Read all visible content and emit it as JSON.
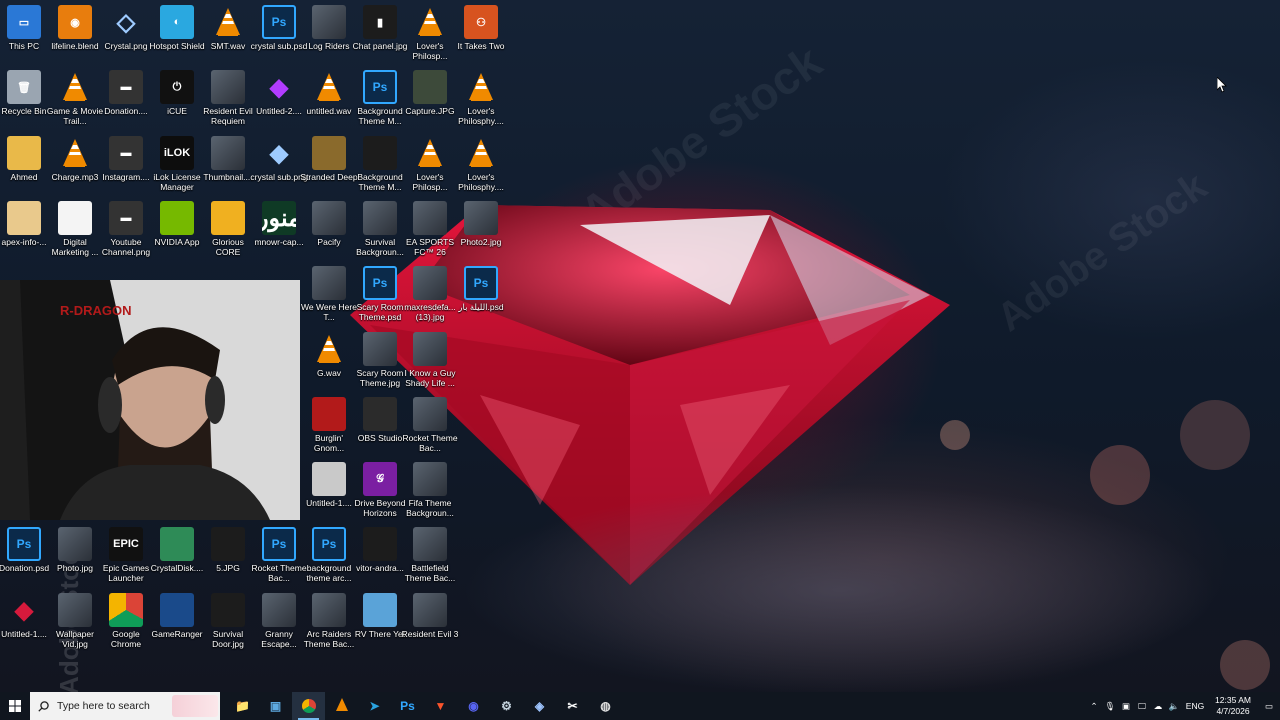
{
  "desktop_icons": [
    {
      "label": "This PC",
      "kind": "pc",
      "glyph": "▭"
    },
    {
      "label": "lifeline.blend",
      "kind": "blender",
      "glyph": "◉"
    },
    {
      "label": "Crystal.png",
      "kind": "crystal",
      "glyph": "◇"
    },
    {
      "label": "Hotspot Shield",
      "kind": "hotspot",
      "glyph": "◐"
    },
    {
      "label": "SMT.wav",
      "kind": "vlc",
      "glyph": ""
    },
    {
      "label": "crystal sub.psd",
      "kind": "ps",
      "glyph": "Ps"
    },
    {
      "label": "Log Riders",
      "kind": "img",
      "glyph": ""
    },
    {
      "label": "Chat panel.jpg",
      "kind": "dark",
      "glyph": "▮"
    },
    {
      "label": "Lover's Philosp...",
      "kind": "vlc",
      "glyph": ""
    },
    {
      "label": "It Takes Two",
      "kind": "ittt",
      "glyph": "⚇"
    },
    {
      "label": "Recycle Bin",
      "kind": "bin",
      "glyph": "🗑"
    },
    {
      "label": "Game & Movie Trail...",
      "kind": "vlc",
      "glyph": ""
    },
    {
      "label": "Donation....",
      "kind": "donation",
      "glyph": "▬"
    },
    {
      "label": "iCUE",
      "kind": "icue",
      "glyph": "⏻"
    },
    {
      "label": "Resident Evil Requiem",
      "kind": "img",
      "glyph": ""
    },
    {
      "label": "Untitled-2....",
      "kind": "purplegem",
      "glyph": "◆"
    },
    {
      "label": "untitled.wav",
      "kind": "vlc",
      "glyph": ""
    },
    {
      "label": "Background Theme M...",
      "kind": "ps",
      "glyph": "Ps"
    },
    {
      "label": "Capture.JPG",
      "kind": "capture",
      "glyph": ""
    },
    {
      "label": "Lover's Philosphy....",
      "kind": "vlc",
      "glyph": ""
    },
    {
      "label": "Ahmed",
      "kind": "folder",
      "glyph": ""
    },
    {
      "label": "Charge.mp3",
      "kind": "vlc",
      "glyph": ""
    },
    {
      "label": "Instagram....",
      "kind": "donation",
      "glyph": "▬"
    },
    {
      "label": "iLok License Manager",
      "kind": "ilok",
      "glyph": "iLOK"
    },
    {
      "label": "Thumbnail....",
      "kind": "img",
      "glyph": ""
    },
    {
      "label": "crystal sub.png",
      "kind": "crystal",
      "glyph": "◆"
    },
    {
      "label": "Stranded Deep",
      "kind": "stranded",
      "glyph": ""
    },
    {
      "label": "Background Theme M...",
      "kind": "dark",
      "glyph": ""
    },
    {
      "label": "Lover's Philosp...",
      "kind": "vlc",
      "glyph": ""
    },
    {
      "label": "Lover's Philosphy....",
      "kind": "vlc",
      "glyph": ""
    },
    {
      "label": "apex-info-...",
      "kind": "apex",
      "glyph": ""
    },
    {
      "label": "Digital Marketing ...",
      "kind": "doc",
      "glyph": ""
    },
    {
      "label": "Youtube Channel.png",
      "kind": "donation",
      "glyph": "▬"
    },
    {
      "label": "NVIDIA App",
      "kind": "nvidia",
      "glyph": ""
    },
    {
      "label": "Glorious CORE",
      "kind": "glorious",
      "glyph": ""
    },
    {
      "label": "mnowr-cap...",
      "kind": "mnowr",
      "glyph": "منور"
    },
    {
      "label": "Pacify",
      "kind": "img",
      "glyph": ""
    },
    {
      "label": "Survival Backgroun...",
      "kind": "img",
      "glyph": ""
    },
    {
      "label": "EA SPORTS FC™ 26",
      "kind": "img",
      "glyph": ""
    },
    {
      "label": "Photo2.jpg",
      "kind": "img",
      "glyph": ""
    },
    {
      "label": "We Were Here T...",
      "kind": "img",
      "glyph": ""
    },
    {
      "label": "Scary Room Theme.psd",
      "kind": "ps",
      "glyph": "Ps"
    },
    {
      "label": "maxresdefa... (13).jpg",
      "kind": "img",
      "glyph": ""
    },
    {
      "label": "الليلة بار.psd",
      "kind": "ps",
      "glyph": "Ps"
    },
    {
      "label": "G.wav",
      "kind": "vlc",
      "glyph": ""
    },
    {
      "label": "Scary Room Theme.jpg",
      "kind": "img",
      "glyph": ""
    },
    {
      "label": "I Know a Guy Shady Life ...",
      "kind": "img",
      "glyph": ""
    },
    {
      "label": "Burglin' Gnom...",
      "kind": "burglin",
      "glyph": ""
    },
    {
      "label": "OBS Studio",
      "kind": "obs",
      "glyph": ""
    },
    {
      "label": "Rocket Theme Bac...",
      "kind": "img",
      "glyph": ""
    },
    {
      "label": "Untitled-1....",
      "kind": "gray",
      "glyph": ""
    },
    {
      "label": "Drive Beyond Horizons",
      "kind": "drive",
      "glyph": "𝒢"
    },
    {
      "label": "Fifa Theme Backgroun...",
      "kind": "img",
      "glyph": ""
    },
    {
      "label": "Donation.psd",
      "kind": "ps",
      "glyph": "Ps"
    },
    {
      "label": "Photo.jpg",
      "kind": "img",
      "glyph": ""
    },
    {
      "label": "Epic Games Launcher",
      "kind": "epic",
      "glyph": "EPIC"
    },
    {
      "label": "CrystalDisk....",
      "kind": "crystaldisk",
      "glyph": ""
    },
    {
      "label": "5.JPG",
      "kind": "dark",
      "glyph": ""
    },
    {
      "label": "Rocket Theme Bac...",
      "kind": "ps",
      "glyph": "Ps"
    },
    {
      "label": "background theme arc...",
      "kind": "ps",
      "glyph": "Ps"
    },
    {
      "label": "vitor-andra...",
      "kind": "dark",
      "glyph": ""
    },
    {
      "label": "Battlefield Theme Bac...",
      "kind": "img",
      "glyph": ""
    },
    {
      "label": "Untitled-1....",
      "kind": "redgem",
      "glyph": "◆"
    },
    {
      "label": "Wallpaper Vid.jpg",
      "kind": "img",
      "glyph": ""
    },
    {
      "label": "Google Chrome",
      "kind": "chrome",
      "glyph": ""
    },
    {
      "label": "GameRanger",
      "kind": "gameranger",
      "glyph": ""
    },
    {
      "label": "Survival Door.jpg",
      "kind": "dark",
      "glyph": ""
    },
    {
      "label": "Granny Escape...",
      "kind": "img",
      "glyph": ""
    },
    {
      "label": "Arc Raiders Theme Bac...",
      "kind": "img",
      "glyph": ""
    },
    {
      "label": "RV There Yet",
      "kind": "rv",
      "glyph": ""
    },
    {
      "label": "Resident Evil 3",
      "kind": "img",
      "glyph": ""
    }
  ],
  "taskbar": {
    "search_placeholder": "Type here to search",
    "apps": [
      {
        "name": "file-explorer",
        "glyph": "📁"
      },
      {
        "name": "app-window",
        "glyph": "▣"
      },
      {
        "name": "chrome",
        "glyph": ""
      },
      {
        "name": "vlc",
        "glyph": ""
      },
      {
        "name": "telegram",
        "glyph": "➤"
      },
      {
        "name": "photoshop",
        "glyph": "Ps"
      },
      {
        "name": "brave",
        "glyph": "▼"
      },
      {
        "name": "discord",
        "glyph": "◉"
      },
      {
        "name": "steam",
        "glyph": "⚙"
      },
      {
        "name": "source-control",
        "glyph": "◈"
      },
      {
        "name": "capcut",
        "glyph": "✂"
      },
      {
        "name": "obs",
        "glyph": "◍"
      }
    ],
    "tray": {
      "language": "ENG",
      "time": "12:35 AM",
      "date": "4/7/2026"
    }
  },
  "colors": {
    "taskbar_bg": "#10161f",
    "ps_blue": "#31a8ff",
    "gem_red": "#c4102e",
    "active_indicator": "#76b9ed"
  },
  "watermark": "Adobe Stock"
}
